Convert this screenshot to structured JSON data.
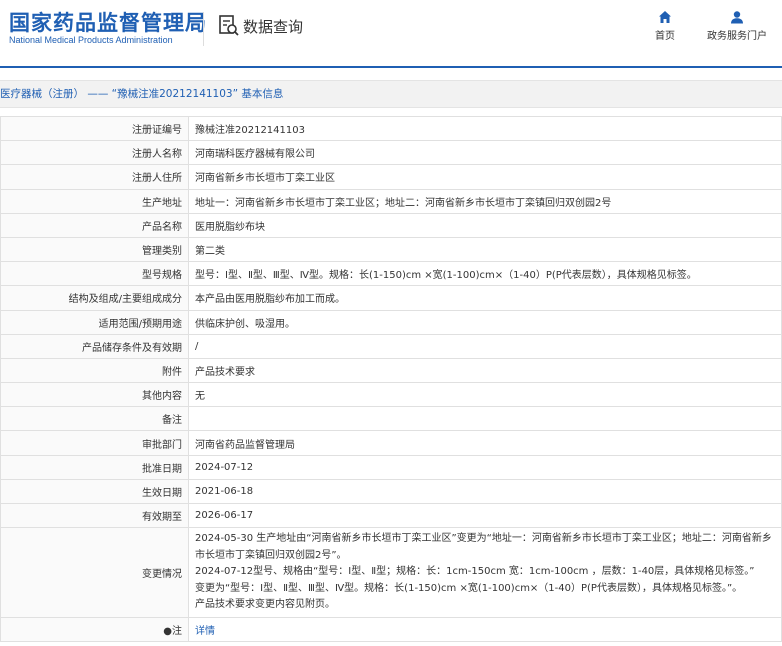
{
  "header": {
    "logo_cn": "国家药品监督管理局",
    "logo_en": "National Medical Products Administration",
    "query_label": "数据查询",
    "nav": [
      {
        "label": "首页",
        "icon": "home-icon"
      },
      {
        "label": "政务服务门户",
        "icon": "user-icon"
      }
    ]
  },
  "breadcrumb": "医疗器械（注册） —— “豫械注准20212141103” 基本信息",
  "rows": [
    {
      "label": "注册证编号",
      "value": "豫械注准20212141103"
    },
    {
      "label": "注册人名称",
      "value": "河南瑞科医疗器械有限公司"
    },
    {
      "label": "注册人住所",
      "value": "河南省新乡市长垣市丁栾工业区"
    },
    {
      "label": "生产地址",
      "value": "地址一：河南省新乡市长垣市丁栾工业区；地址二：河南省新乡市长垣市丁栾镇回归双创园2号"
    },
    {
      "label": "产品名称",
      "value": "医用脱脂纱布块"
    },
    {
      "label": "管理类别",
      "value": "第二类"
    },
    {
      "label": "型号规格",
      "value": "型号：Ⅰ型、Ⅱ型、Ⅲ型、Ⅳ型。规格：长(1-150)cm ×宽(1-100)cm×（1-40）P(P代表层数），具体规格见标签。"
    },
    {
      "label": "结构及组成/主要组成成分",
      "value": "本产品由医用脱脂纱布加工而成。"
    },
    {
      "label": "适用范围/预期用途",
      "value": "供临床护创、吸湿用。"
    },
    {
      "label": "产品储存条件及有效期",
      "value": "/"
    },
    {
      "label": "附件",
      "value": "产品技术要求"
    },
    {
      "label": "其他内容",
      "value": "无"
    },
    {
      "label": "备注",
      "value": ""
    },
    {
      "label": "审批部门",
      "value": "河南省药品监督管理局"
    },
    {
      "label": "批准日期",
      "value": "2024-07-12"
    },
    {
      "label": "生效日期",
      "value": "2021-06-18"
    },
    {
      "label": "有效期至",
      "value": "2026-06-17"
    }
  ],
  "change": {
    "label": "变更情况",
    "lines": [
      "2024-05-30 生产地址由“河南省新乡市长垣市丁栾工业区”变更为“地址一：河南省新乡市长垣市丁栾工业区；地址二：河南省新乡",
      "市长垣市丁栾镇回归双创园2号”。",
      "2024-07-12型号、规格由“型号：Ⅰ型、Ⅱ型；规格：长：1cm-150cm 宽：1cm-100cm ，层数：1-40层，具体规格见标签。”",
      "变更为“型号：Ⅰ型、Ⅱ型、Ⅲ型、Ⅳ型。规格：长(1-150)cm ×宽(1-100)cm×（1-40）P(P代表层数），具体规格见标签。”。",
      "产品技术要求变更内容见附页。"
    ]
  },
  "note": {
    "label": "●注",
    "link": "详情"
  }
}
